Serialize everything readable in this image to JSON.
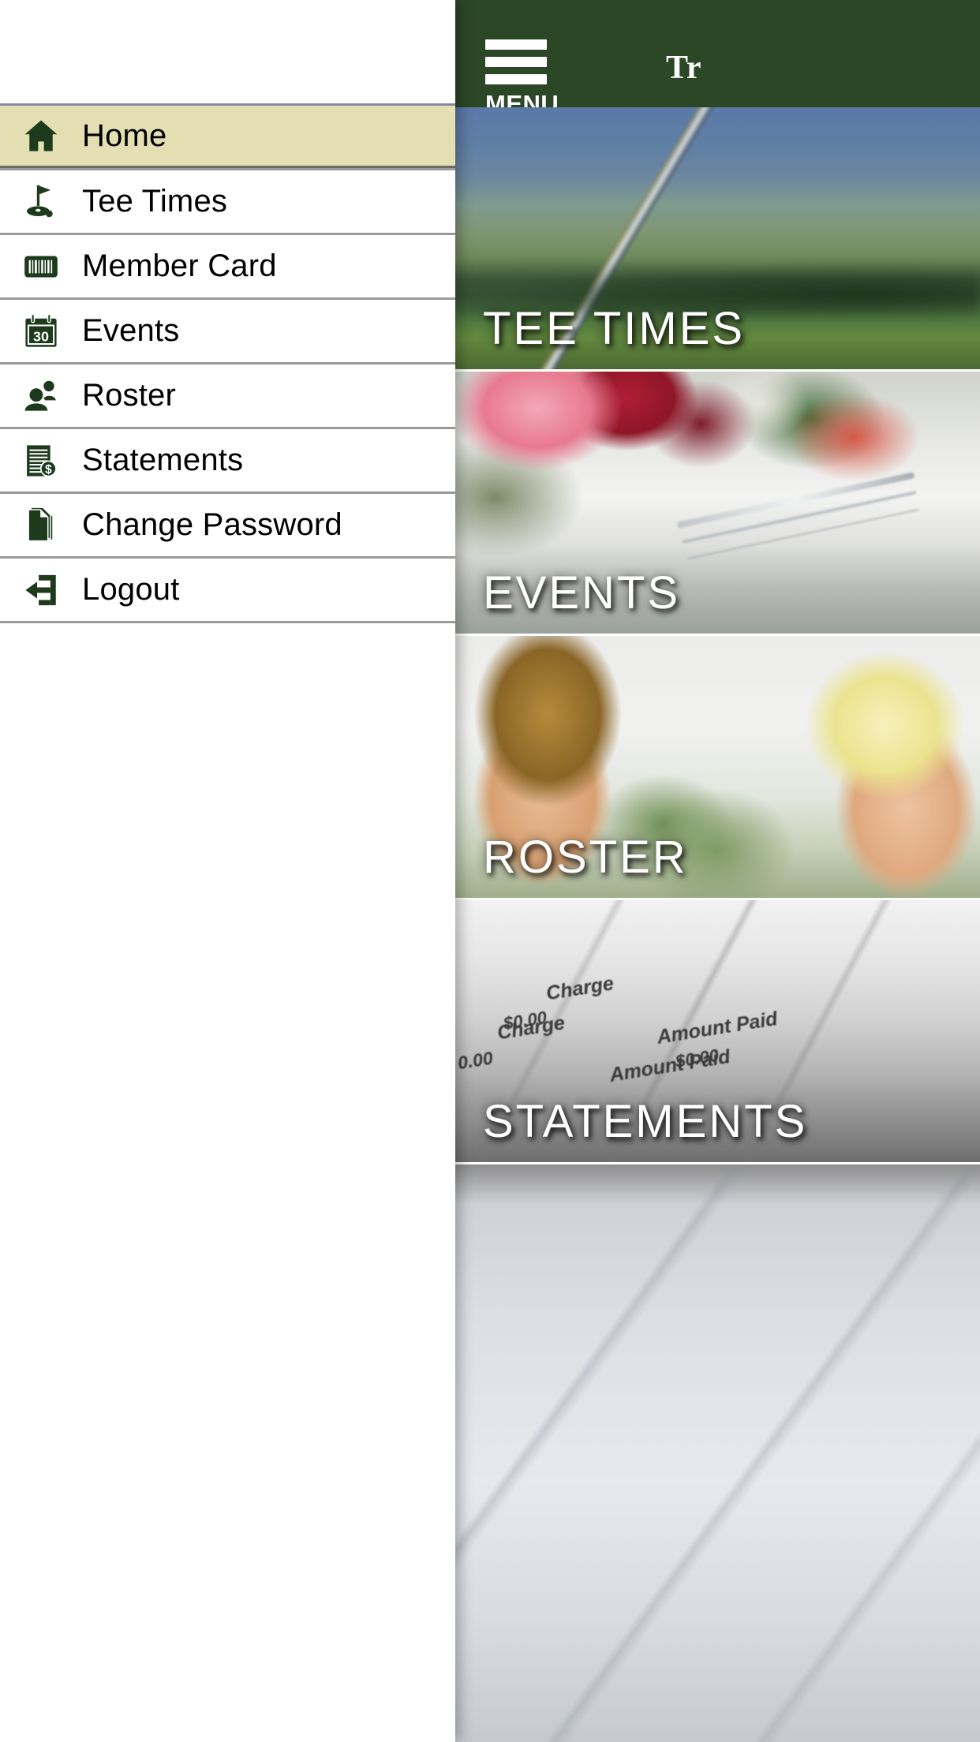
{
  "app": {
    "header": {
      "menu_button_label": "MENU",
      "menu_icon": "hamburger-menu-icon",
      "title": "Tr",
      "background_color": "#2b4726"
    },
    "tiles": [
      {
        "key": "tee_times",
        "label": "TEE TIMES",
        "image": "golf-club-on-grass-photo"
      },
      {
        "key": "events",
        "label": "EVENTS",
        "image": "banquet-table-flowers-photo"
      },
      {
        "key": "roster",
        "label": "ROSTER",
        "image": "smiling-golfer-couple-photo"
      },
      {
        "key": "statements",
        "label": "STATEMENTS",
        "image": "printed-statement-document-photo"
      },
      {
        "key": "extra",
        "label": "",
        "image": "document-closeup-photo"
      }
    ],
    "statement_image_text": [
      "Charge",
      "$0.00",
      "Amount Paid",
      "Charge",
      "$0.00",
      "Amount Paid",
      "0.00"
    ]
  },
  "drawer": {
    "active_item": "Home",
    "highlight_color": "#e4dfb2",
    "icon_color": "#1d3b1c",
    "items": [
      {
        "label": "Home",
        "icon": "home-icon"
      },
      {
        "label": "Tee Times",
        "icon": "golf-flag-icon"
      },
      {
        "label": "Member Card",
        "icon": "barcode-icon"
      },
      {
        "label": "Events",
        "icon": "calendar-icon",
        "icon_text": "30"
      },
      {
        "label": "Roster",
        "icon": "people-icon"
      },
      {
        "label": "Statements",
        "icon": "document-dollar-icon"
      },
      {
        "label": "Change Password",
        "icon": "document-pages-icon"
      },
      {
        "label": "Logout",
        "icon": "exit-arrow-icon"
      }
    ]
  }
}
